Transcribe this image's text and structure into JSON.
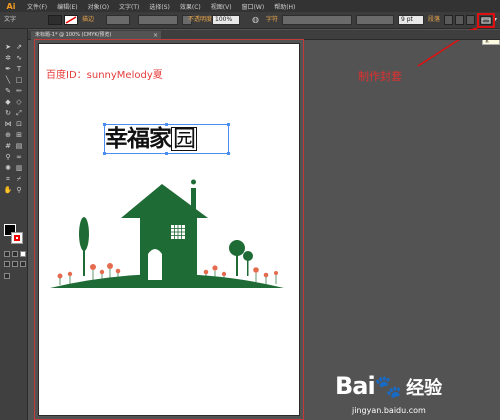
{
  "app": {
    "logo": "Ai"
  },
  "menubar": {
    "items": [
      "文件(F)",
      "编辑(E)",
      "对象(O)",
      "文字(T)",
      "选择(S)",
      "效果(C)",
      "视图(V)",
      "窗口(W)",
      "帮助(H)"
    ]
  },
  "controlbar": {
    "tool_label": "文字",
    "stroke_label": "描边",
    "opacity_label": "不透明度",
    "opacity_value": "100%",
    "char_label": "字符",
    "font_size_value": "9 pt",
    "paragraph_label": "段落"
  },
  "annotation": {
    "text": "制作封套",
    "tooltip": "制作封套"
  },
  "tab": {
    "title": "未标题-1* @ 100% (CMYK/预览)",
    "close": "×"
  },
  "canvas": {
    "watermark_id": "百度ID：sunnyMelody夏",
    "title_main": "幸福家",
    "title_last": "园"
  },
  "watermark": {
    "logo": "Bai",
    "logo_suffix": "经验",
    "url": "jingyan.baidu.com"
  },
  "colors": {
    "house_green": "#1f6b35",
    "annotation_red": "#e01010",
    "flower_red": "#e56b4f"
  }
}
